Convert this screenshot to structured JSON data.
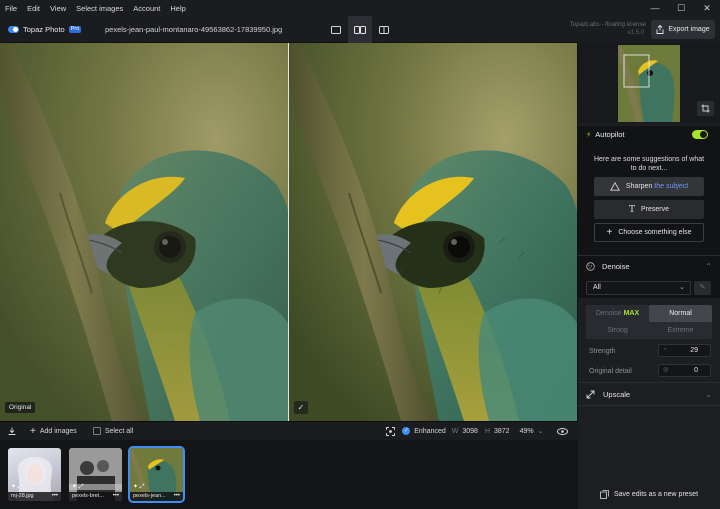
{
  "menu": [
    "File",
    "Edit",
    "View",
    "Select images",
    "Account",
    "Help"
  ],
  "header": {
    "brand": "Topaz Photo",
    "badge": "Pro",
    "filename": "pexels-jean-paul-montanaro-49563862-17839950.jpg",
    "license": "TopazLabs - floating license",
    "version": "v1.5.0",
    "export_label": "Export image"
  },
  "canvas": {
    "left_tag": "Original",
    "right_tag": "✓"
  },
  "toolbar": {
    "add_images": "Add images",
    "select_all": "Select all",
    "enhanced": "Enhanced",
    "w_label": "W",
    "w_value": "3098",
    "h_label": "H",
    "h_value": "3872",
    "zoom": "49%"
  },
  "filmstrip": [
    {
      "label": "mj-28.jpg",
      "selected": false
    },
    {
      "label": "pexels-bret...",
      "selected": false
    },
    {
      "label": "pexels-jean...",
      "selected": true
    }
  ],
  "autopilot": {
    "title": "Autopilot",
    "enabled": true,
    "suggestion": "Here are some suggestions of what to do next...",
    "btn_sharpen": "Sharpen",
    "btn_sharpen_subject": "the subject",
    "btn_preserve": "Preserve",
    "btn_choose": "Choose something else"
  },
  "denoise": {
    "title": "Denoise",
    "scope": "All",
    "modes": [
      "Denoise",
      "MAX",
      "Normal",
      "Strong",
      "Extreme"
    ],
    "selected_mode": "Normal",
    "strength_label": "Strength",
    "strength_value": "29",
    "detail_label": "Original detail",
    "detail_value": "0"
  },
  "upscale": {
    "title": "Upscale"
  },
  "preset": {
    "label": "Save edits as a new preset"
  },
  "colors": {
    "accent_blue": "#3c8cf5",
    "accent_green": "#a6e32b"
  }
}
